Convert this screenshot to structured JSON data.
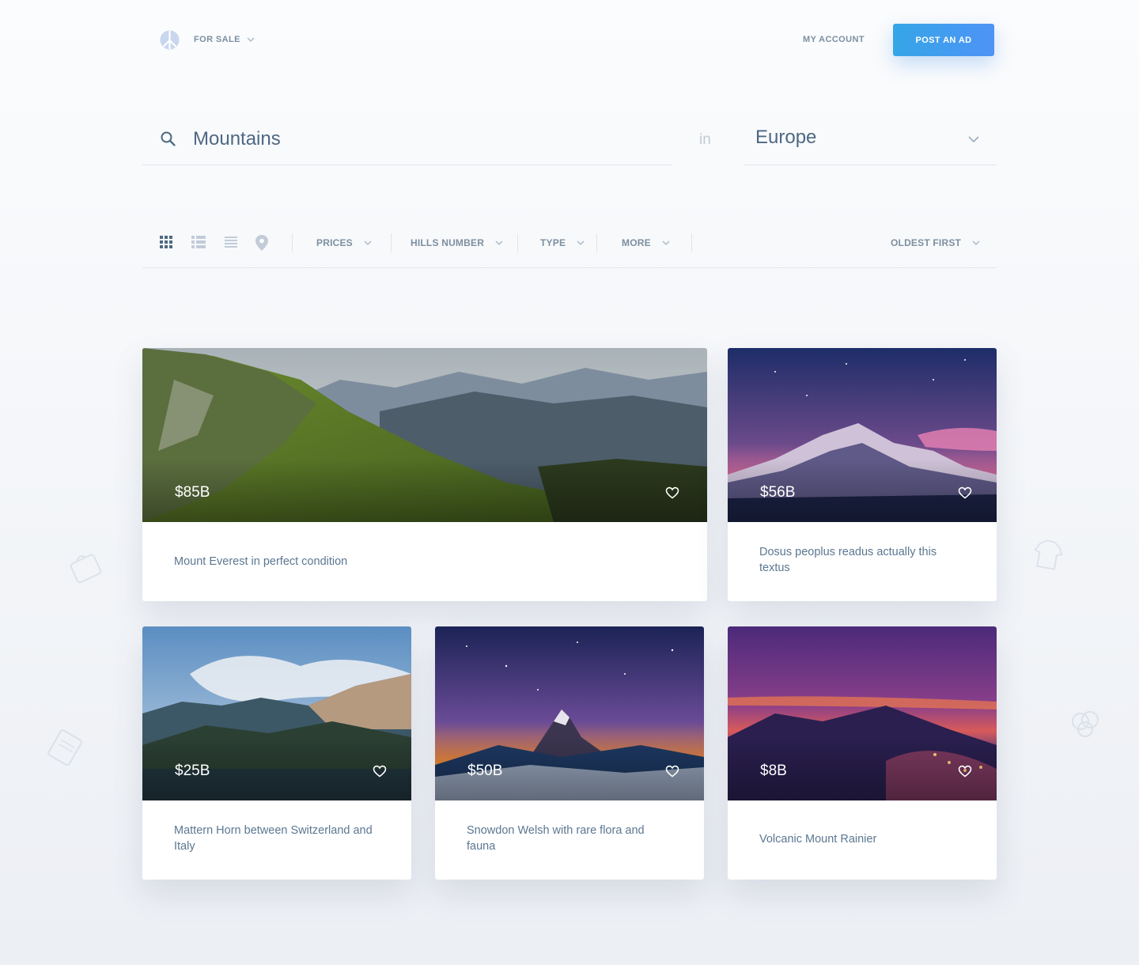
{
  "header": {
    "logo_icon": "peace-logo-icon",
    "category_label": "FOR SALE",
    "account_label": "MY ACCOUNT",
    "post_button_label": "POST AN AD"
  },
  "search": {
    "query": "Mountains",
    "placeholder": "Search",
    "in_label": "in",
    "region": "Europe"
  },
  "filters": {
    "view_modes": [
      "grid-view-icon",
      "list-view-icon",
      "compact-list-icon",
      "map-pin-icon"
    ],
    "prices_label": "PRICES",
    "hills_label": "HILLS NUMBER",
    "type_label": "TYPE",
    "more_label": "MORE",
    "sort_label": "OLDEST FIRST"
  },
  "colors": {
    "accent": "#3f9cf0",
    "text": "#4e6a82",
    "muted": "#7d8fa0"
  },
  "listings": [
    {
      "price": "$85B",
      "title": "Mount Everest in perfect condition"
    },
    {
      "price": "$56B",
      "title": "Dosus peoplus readus actually this textus"
    },
    {
      "price": "$25B",
      "title": "Mattern Horn between Switzerland and Italy"
    },
    {
      "price": "$50B",
      "title": "Snowdon Welsh with rare flora and fauna"
    },
    {
      "price": "$8B",
      "title": "Volcanic Mount Rainier"
    }
  ]
}
